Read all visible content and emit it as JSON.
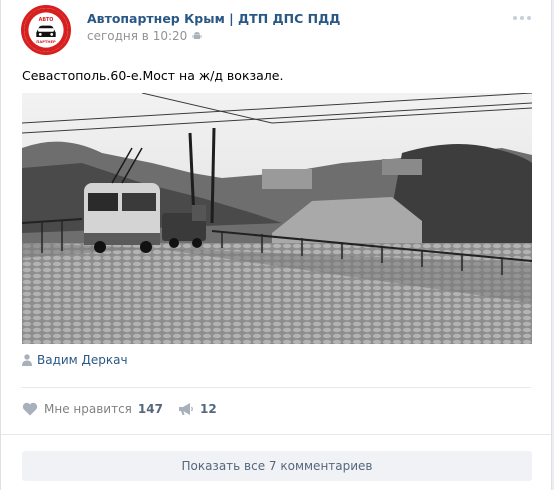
{
  "post": {
    "author": "Автопартнер Крым | ДТП ДПС ПДД",
    "time": "сегодня в 10:20",
    "text": "Севастополь.60-е.Мост на ж/д вокзале.",
    "signer": "Вадим Деркач",
    "avatar": {
      "line1": "АВТО",
      "line2": "ПАРТНЕР"
    }
  },
  "actions": {
    "like_label": "Мне нравится",
    "like_count": "147",
    "share_count": "12"
  },
  "comments": {
    "show_all_label": "Показать все 7 комментариев"
  },
  "colors": {
    "link": "#2a5885",
    "meta": "#939393",
    "avatar_ring": "#d81f1f"
  }
}
